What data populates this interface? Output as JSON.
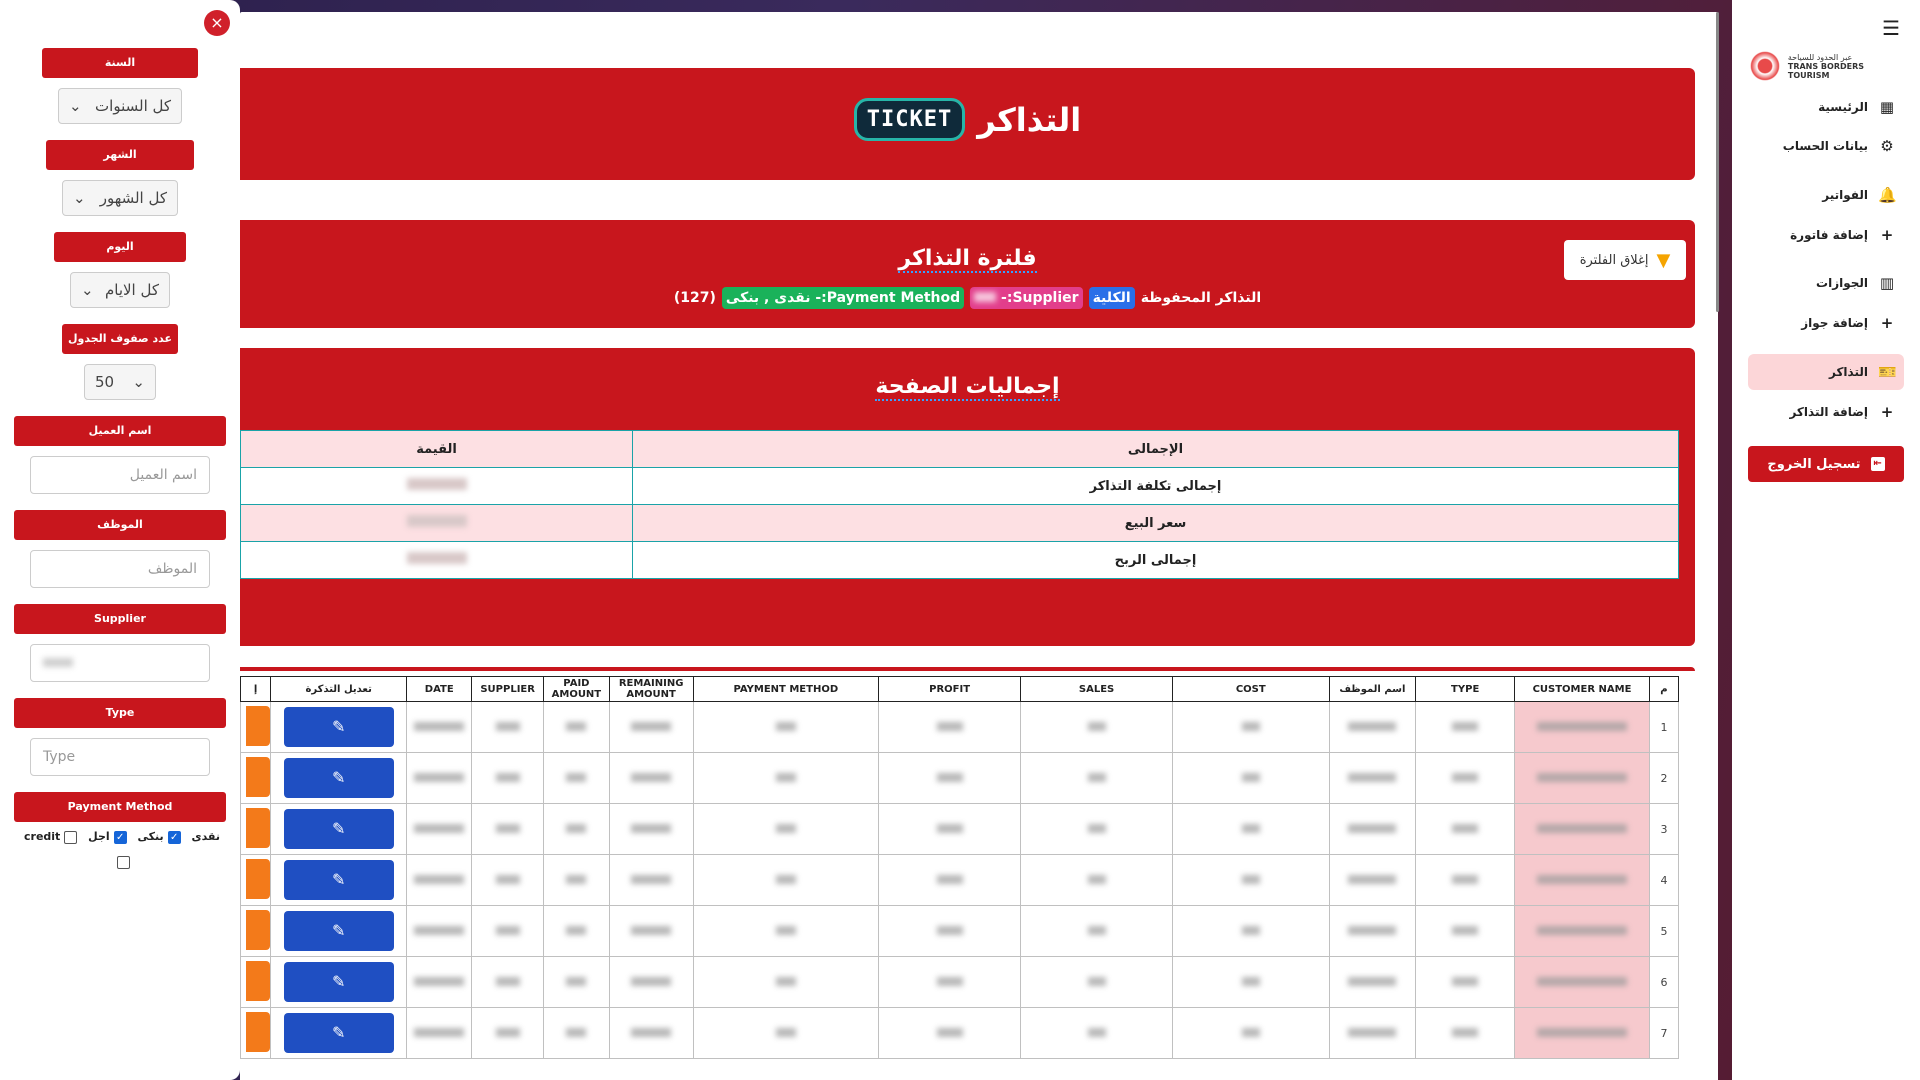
{
  "header": {
    "logo_text": "TICKET",
    "title": "التذاكر"
  },
  "filter": {
    "title": "فلترة التذاكر",
    "close_label": "إغلاق الفلترة",
    "saved_label": "التذاكر المحفوظة",
    "chip_all": "الكلية",
    "chip_supplier": "Supplier:-",
    "chip_payment": "Payment Method:- نقدى , بنكى",
    "count": "(127)"
  },
  "totals": {
    "title": "إجماليات الصفحة",
    "col_total": "الإجمالى",
    "col_value": "القيمة",
    "rows": [
      "إجمالى تكلفة التذاكر",
      "سعر البيع",
      "إجمالى الربح"
    ]
  },
  "table": {
    "headers": [
      "م",
      "CUSTOMER NAME",
      "TYPE",
      "اسم الموظف",
      "COST",
      "SALES",
      "PROFIT",
      "PAYMENT METHOD",
      "REMAINING AMOUNT",
      "PAID AMOUNT",
      "SUPPLIER",
      "DATE",
      "تعديل التذكرة",
      "إ"
    ],
    "rows": [
      "1",
      "2",
      "3",
      "4",
      "5",
      "6",
      "7"
    ],
    "edit_icon": "✎"
  },
  "left": {
    "close": "×",
    "year_label": "السنة",
    "year_value": "كل السنوات",
    "month_label": "الشهر",
    "month_value": "كل الشهور",
    "day_label": "اليوم",
    "day_value": "كل الايام",
    "rows_label": "عدد صفوف الجدول",
    "rows_value": "50",
    "client_label": "اسم العميل",
    "client_placeholder": "اسم العميل",
    "employee_label": "الموظف",
    "employee_placeholder": "الموظف",
    "supplier_label": "Supplier",
    "type_label": "Type",
    "type_placeholder": "Type",
    "payment_label": "Payment Method",
    "pm_cash": "نقدى",
    "pm_bank": "بنكى",
    "pm_later": "اجل",
    "pm_credit": "credit"
  },
  "sidebar": {
    "brand_ar": "عبر الحدود للسياحة",
    "brand_en": "TRANS BORDERS TOURISM",
    "items": [
      "الرئيسية",
      "بيانات الحساب",
      "الفواتير",
      "إضافة فاتورة",
      "الجوازات",
      "إضافة جواز",
      "التذاكر",
      "إضافة التذاكر"
    ],
    "logout": "تسجيل الخروج"
  },
  "colors": {
    "primary": "#c8161d",
    "accent_blue": "#1f4fc2",
    "accent_orange": "#f37a1a",
    "active_bg": "#fcd6d8"
  }
}
